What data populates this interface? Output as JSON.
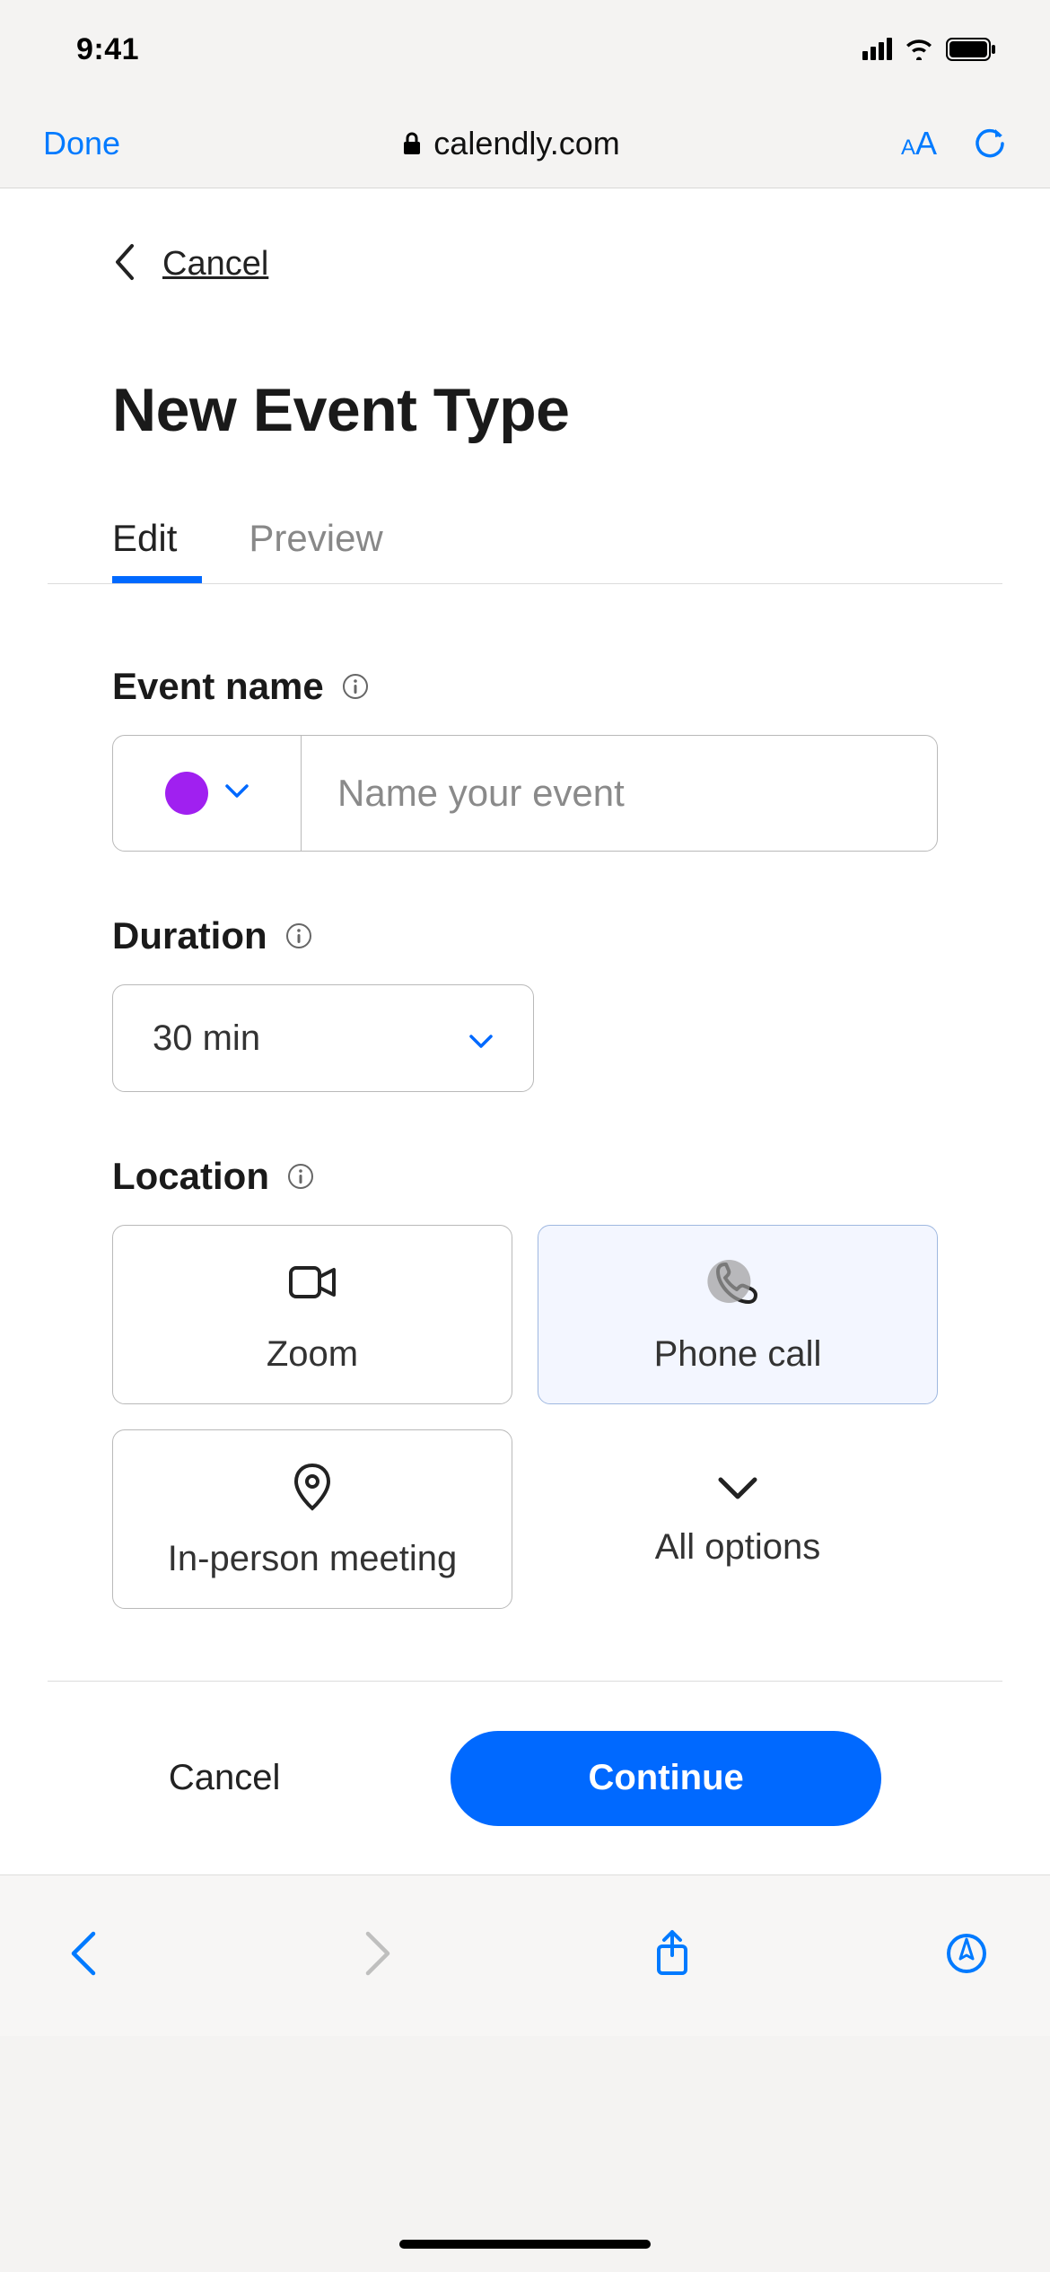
{
  "status": {
    "time": "9:41"
  },
  "browser": {
    "done": "Done",
    "domain": "calendly.com"
  },
  "page": {
    "cancel_link": "Cancel",
    "title": "New Event Type",
    "tabs": {
      "edit": "Edit",
      "preview": "Preview"
    }
  },
  "form": {
    "event_name_label": "Event name",
    "event_name_placeholder": "Name your event",
    "color": "#a020f0",
    "duration_label": "Duration",
    "duration_value": "30 min",
    "location_label": "Location",
    "locations": {
      "zoom": "Zoom",
      "phone": "Phone call",
      "inperson": "In-person meeting",
      "all": "All options"
    }
  },
  "footer": {
    "cancel": "Cancel",
    "continue": "Continue"
  }
}
